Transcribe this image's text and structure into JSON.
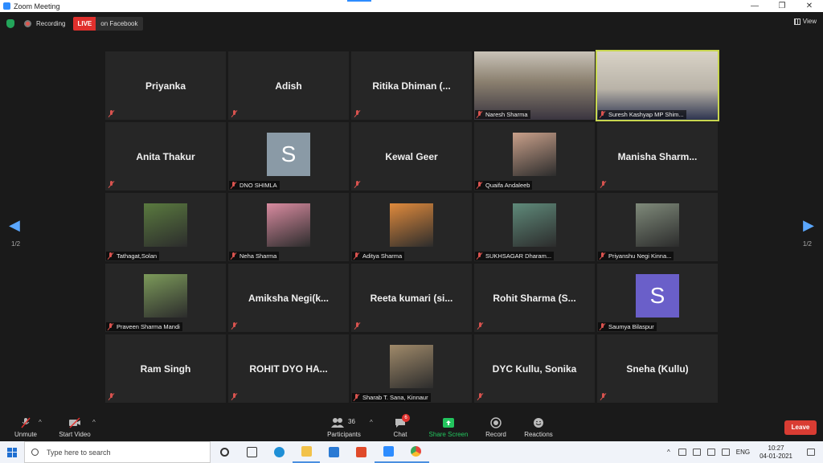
{
  "window": {
    "title": "Zoom Meeting",
    "minimize": "—",
    "restore": "❐",
    "close": "✕"
  },
  "topbar": {
    "recording_label": "Recording",
    "live_label": "LIVE",
    "live_target": "on Facebook",
    "view_label": "View"
  },
  "pager": {
    "left": "1/2",
    "right": "1/2"
  },
  "tiles": [
    {
      "name": "Priyanka",
      "type": "name"
    },
    {
      "name": "Adish",
      "type": "name"
    },
    {
      "name": "Ritika  Dhiman  (...",
      "type": "name"
    },
    {
      "name": "Naresh Sharma",
      "type": "video"
    },
    {
      "name": "Suresh Kashyap MP Shim...",
      "type": "video"
    },
    {
      "name": "Anita Thakur",
      "type": "name"
    },
    {
      "name": "DNO SHIMLA",
      "type": "letter",
      "letter": "S",
      "color": "#8a9aa6"
    },
    {
      "name": "Kewal Geer",
      "type": "name"
    },
    {
      "name": "Quaifa Andaleeb",
      "type": "photo",
      "color": "#c9a08a"
    },
    {
      "name": "Manisha  Sharm...",
      "type": "name"
    },
    {
      "name": "Tathagat,Solan",
      "type": "photo",
      "color": "#5a7a3f"
    },
    {
      "name": "Neha Sharma",
      "type": "photo",
      "color": "#d98ba0"
    },
    {
      "name": "Aditya Sharma",
      "type": "photo",
      "color": "#e08a3c"
    },
    {
      "name": "SUKHSAGAR Dharam...",
      "type": "photo",
      "color": "#5f8a7a"
    },
    {
      "name": "Priyanshu Negi Kinna...",
      "type": "photo",
      "color": "#7f8a7a"
    },
    {
      "name": "Praveen Sharma Mandi",
      "type": "photo",
      "color": "#7c9a5a"
    },
    {
      "name": "Amiksha  Negi(k...",
      "type": "name"
    },
    {
      "name": "Reeta  kumari  (si...",
      "type": "name"
    },
    {
      "name": "Rohit  Sharma  (S...",
      "type": "name"
    },
    {
      "name": "Saumya Bilaspur",
      "type": "letter",
      "letter": "S",
      "color": "#6a5fc9"
    },
    {
      "name": "Ram Singh",
      "type": "name"
    },
    {
      "name": "ROHIT  DYO  HA...",
      "type": "name"
    },
    {
      "name": "Sharab T. Sana, Kinnaur",
      "type": "photo",
      "color": "#a08a6a"
    },
    {
      "name": "DYC Kullu, Sonika",
      "type": "name"
    },
    {
      "name": "Sneha (Kullu)",
      "type": "name"
    }
  ],
  "toolbar": {
    "unmute": "Unmute",
    "start_video": "Start Video",
    "participants": "Participants",
    "participants_count": "36",
    "chat": "Chat",
    "chat_badge": "6",
    "share_screen": "Share Screen",
    "record": "Record",
    "reactions": "Reactions",
    "leave": "Leave"
  },
  "taskbar": {
    "search_placeholder": "Type here to search",
    "lang": "ENG",
    "time": "10:27",
    "date": "04-01-2021"
  },
  "colors": {
    "accent": "#2d8cff",
    "live": "#e0302d",
    "share": "#23c55e",
    "active_border": "#c8d650"
  }
}
